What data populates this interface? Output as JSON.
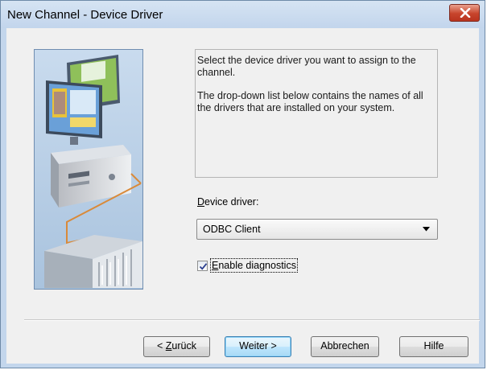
{
  "window": {
    "title": "New Channel - Device Driver",
    "close_icon": "close-icon"
  },
  "illustration": {
    "icon": "pc-and-plc-network-illustration"
  },
  "description": {
    "line1": "Select the device driver you want to assign to the channel.",
    "line2": "The drop-down list below contains the names of all the drivers that are installed on your system."
  },
  "device_driver": {
    "label_accel": "D",
    "label_rest": "evice driver:",
    "value": "ODBC Client"
  },
  "diagnostics": {
    "label_accel": "E",
    "label_rest": "nable diagnostics",
    "checked": true
  },
  "buttons": {
    "back_prefix": "< ",
    "back_accel": "Z",
    "back_rest": "urück",
    "next": "Weiter >",
    "cancel": "Abbrechen",
    "help": "Hilfe"
  },
  "colors": {
    "title_bar": "#c2d5ec",
    "dialog_bg": "#f0f0f0",
    "close_button": "#c7442c"
  }
}
